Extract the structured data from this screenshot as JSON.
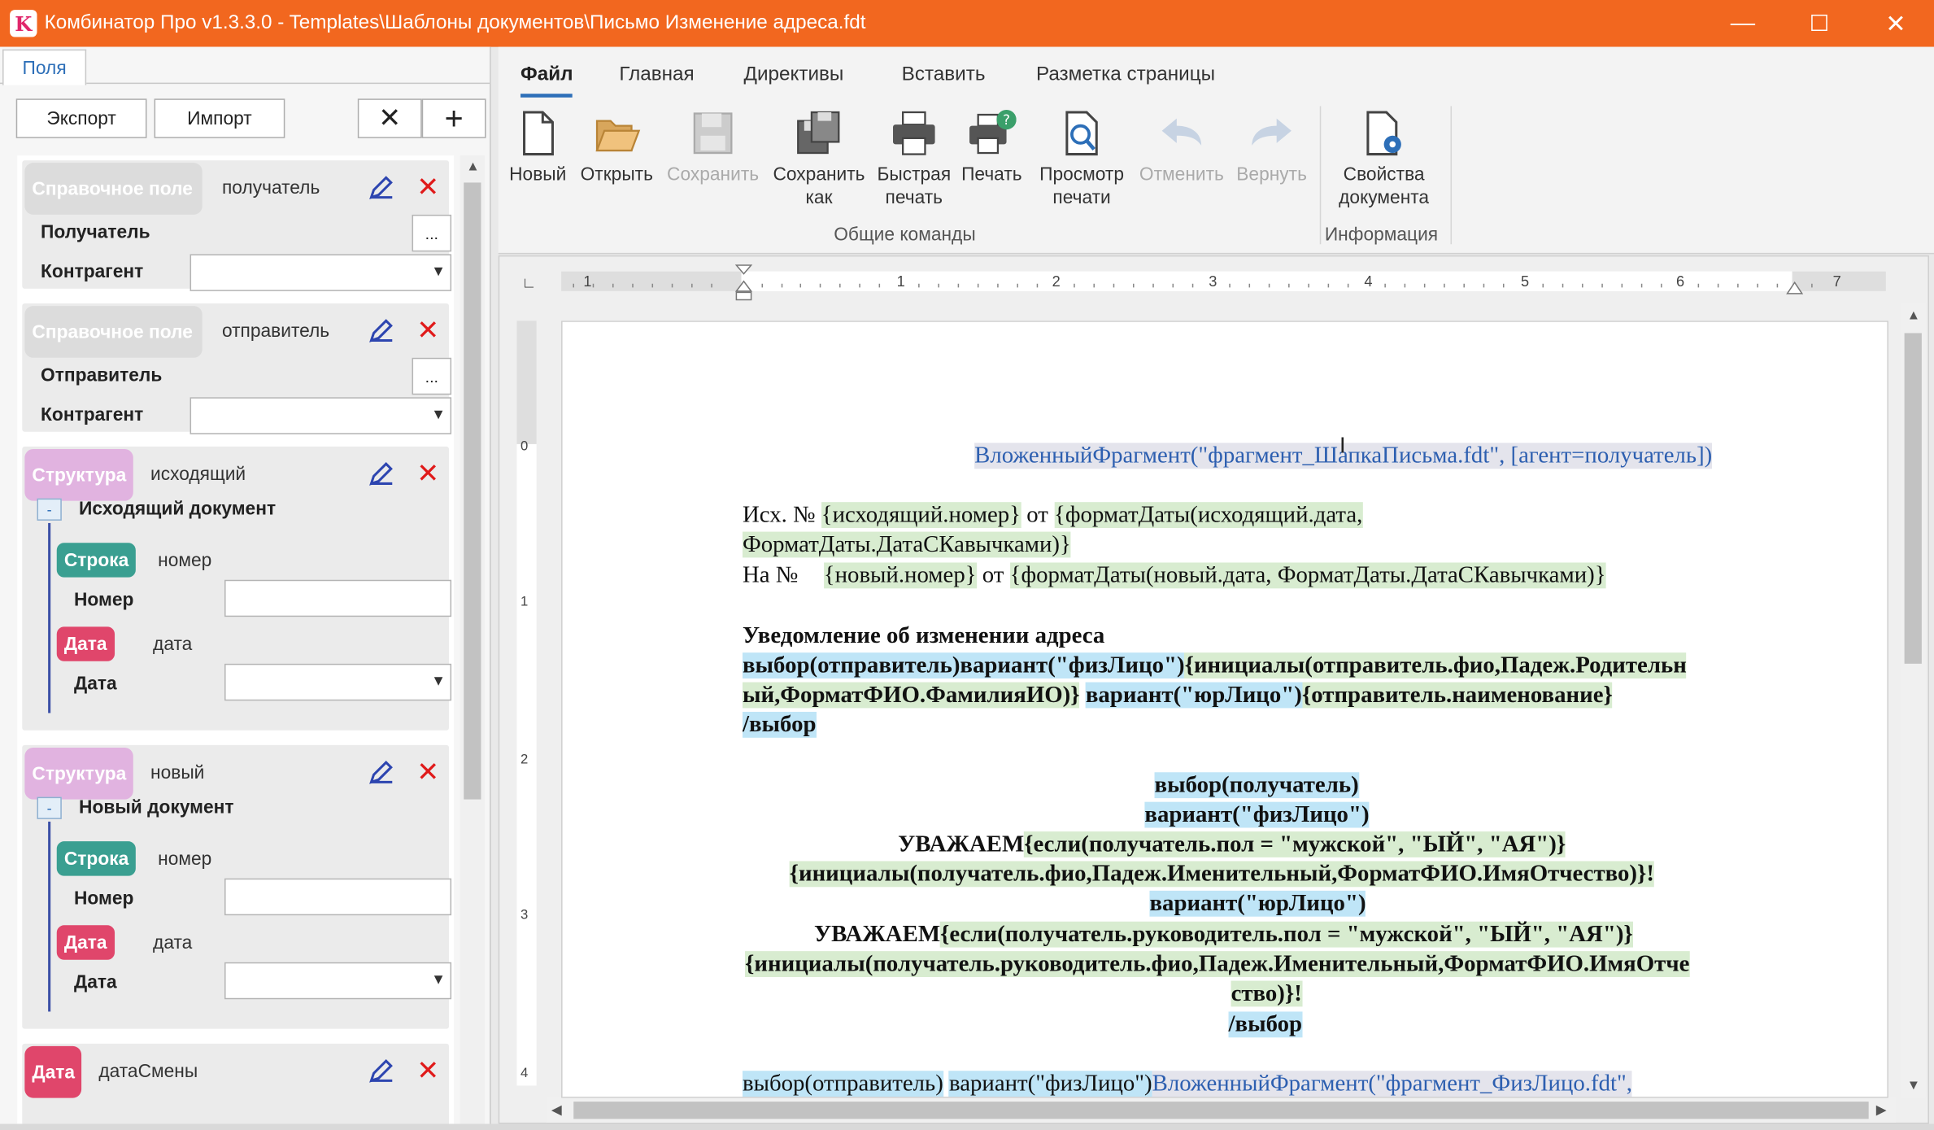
{
  "window": {
    "title": "Комбинатор Про v1.3.3.0 - Templates\\Шаблоны документов\\Письмо Изменение адреса.fdt",
    "logo_letter": "K",
    "minimize": "—",
    "maximize": "☐",
    "close": "✕"
  },
  "left": {
    "tab": "Поля",
    "export": "Экспорт",
    "import": "Импорт",
    "delete": "✕",
    "add": "+",
    "cards": {
      "c1": {
        "chip": "Справочное поле",
        "name": "получатель",
        "l1": "Получатель",
        "l2": "Контрагент",
        "ellipsis": "..."
      },
      "c2": {
        "chip": "Справочное поле",
        "name": "отправитель",
        "l1": "Отправитель",
        "l2": "Контрагент",
        "ellipsis": "..."
      },
      "c3": {
        "chip": "Структура",
        "name": "исходящий",
        "group": "Исходящий документ",
        "collapse": "-",
        "str_chip": "Строка",
        "str_name": "номер",
        "str_label": "Номер",
        "date_chip": "Дата",
        "date_name": "дата",
        "date_label": "Дата"
      },
      "c4": {
        "chip": "Структура",
        "name": "новый",
        "group": "Новый документ",
        "collapse": "-",
        "str_chip": "Строка",
        "str_name": "номер",
        "str_label": "Номер",
        "date_chip": "Дата",
        "date_name": "дата",
        "date_label": "Дата"
      },
      "c5": {
        "chip": "Дата",
        "name": "датаСмены"
      }
    }
  },
  "ribbon": {
    "tabs": [
      "Файл",
      "Главная",
      "Директивы",
      "Вставить",
      "Разметка страницы"
    ],
    "buttons": {
      "new": [
        "Новый"
      ],
      "open": [
        "Открыть"
      ],
      "save": [
        "Сохранить"
      ],
      "saveas": [
        "Сохранить",
        "как"
      ],
      "quickprint": [
        "Быстрая",
        "печать"
      ],
      "print": [
        "Печать"
      ],
      "preview": [
        "Просмотр",
        "печати"
      ],
      "undo": [
        "Отменить"
      ],
      "redo": [
        "Вернуть"
      ],
      "props": [
        "Свойства",
        "документа"
      ]
    },
    "group_common": "Общие команды",
    "group_info": "Информация"
  },
  "ruler": {
    "h_numbers": [
      "1",
      "1",
      "2",
      "3",
      "4",
      "5",
      "6",
      "7"
    ],
    "v_numbers": [
      "0",
      "1",
      "2",
      "3",
      "4"
    ]
  },
  "doc": {
    "l1": "ВложенныйФрагмент(\"фрагмент_ШапкаПисьма.fdt\", [агент=получатель])",
    "l2a": "Исх. № ",
    "l2b": "{исходящий.номер}",
    "l2c": " от ",
    "l2d": "{форматДаты(исходящий.дата,",
    "l3": "ФорматДаты.ДатаСКавычками)}",
    "l4a": "На № ",
    "l4b": "{новый.номер}",
    "l4c": " от ",
    "l4d": "{форматДаты(новый.дата, ФорматДаты.ДатаСКавычками)}",
    "l5": "Уведомление об изменении адреса",
    "l6a": "выбор(отправитель)вариант(\"физЛицо\")",
    "l6b": "{инициалы(отправитель.фио,Падеж.Родительн",
    "l7a": "ый,ФорматФИО.ФамилияИО)}",
    "l7b": " ",
    "l7c": "вариант(\"юрЛицо\")",
    "l7d": "{отправитель.наименование}",
    "l8": "/выбор",
    "l9": "выбор(получатель)",
    "l10": "вариант(\"физЛицо\")",
    "l11a": "УВАЖАЕМ",
    "l11b": "{если(получатель.пол = \"мужской\", \"ЫЙ\", \"АЯ\")}",
    "l12": "{инициалы(получатель.фио,Падеж.Именительный,ФорматФИО.ИмяОтчество)}!",
    "l13": "вариант(\"юрЛицо\")",
    "l14a": "УВАЖАЕМ",
    "l14b": "{если(получатель.руководитель.пол = \"мужской\", \"ЫЙ\", \"АЯ\")}",
    "l15": "{инициалы(получатель.руководитель.фио,Падеж.Именительный,ФорматФИО.ИмяОтче",
    "l16": "ство)}!",
    "l17": "/выбор",
    "l18a": "выбор(отправитель)",
    "l18b": " ",
    "l18c": "вариант(\"физЛицо\")",
    "l18d": "ВложенныйФрагмент(\"фрагмент_ФизЛицо.fdt\","
  },
  "colors": {
    "titlebar": "#f2671f",
    "accent": "#2d6fb8",
    "green_highlight": "#d8ecd0",
    "blue_highlight": "#bfe5f7",
    "delete_red": "#e01a1a"
  }
}
